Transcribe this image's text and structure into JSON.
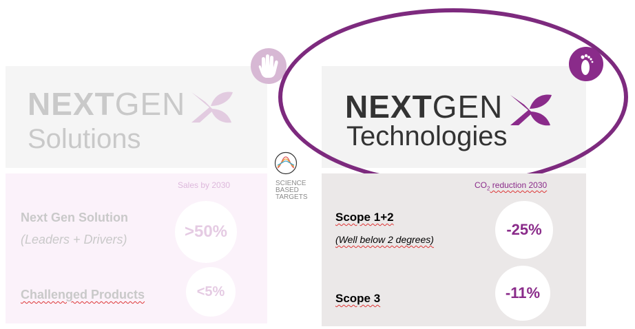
{
  "left_panel": {
    "logo_bold": "NEXT",
    "logo_light": "GEN",
    "logo_subtitle": "Solutions",
    "caption": "Sales by 2030",
    "rows": [
      {
        "title": "Next Gen Solution",
        "subtitle": "(Leaders + Drivers)",
        "value": ">50%"
      },
      {
        "title": "Challenged Products",
        "value": "<5%"
      }
    ]
  },
  "center": {
    "sbt_line1": "SCIENCE",
    "sbt_line2": "BASED",
    "sbt_line3": "TARGETS"
  },
  "right_panel": {
    "logo_bold": "NEXT",
    "logo_light": "GEN",
    "logo_subtitle": "Technologies",
    "caption_prefix": "CO",
    "caption_sub": "2",
    "caption_suffix": " reduction 2030",
    "rows": [
      {
        "title": "Scope 1+2",
        "subtitle": "(Well below 2 degrees)",
        "value": "-25%"
      },
      {
        "title": "Scope 3",
        "value": "-11%"
      }
    ]
  },
  "colors": {
    "accent_purple": "#8a2b8a",
    "faded_purple": "#d7b8d4",
    "faded_text": "#c9c9c9",
    "ellipse_purple": "#7d2a7e"
  },
  "icons": [
    "hand-icon",
    "footprint-icon",
    "leaf-x-icon",
    "science-based-targets-icon"
  ]
}
